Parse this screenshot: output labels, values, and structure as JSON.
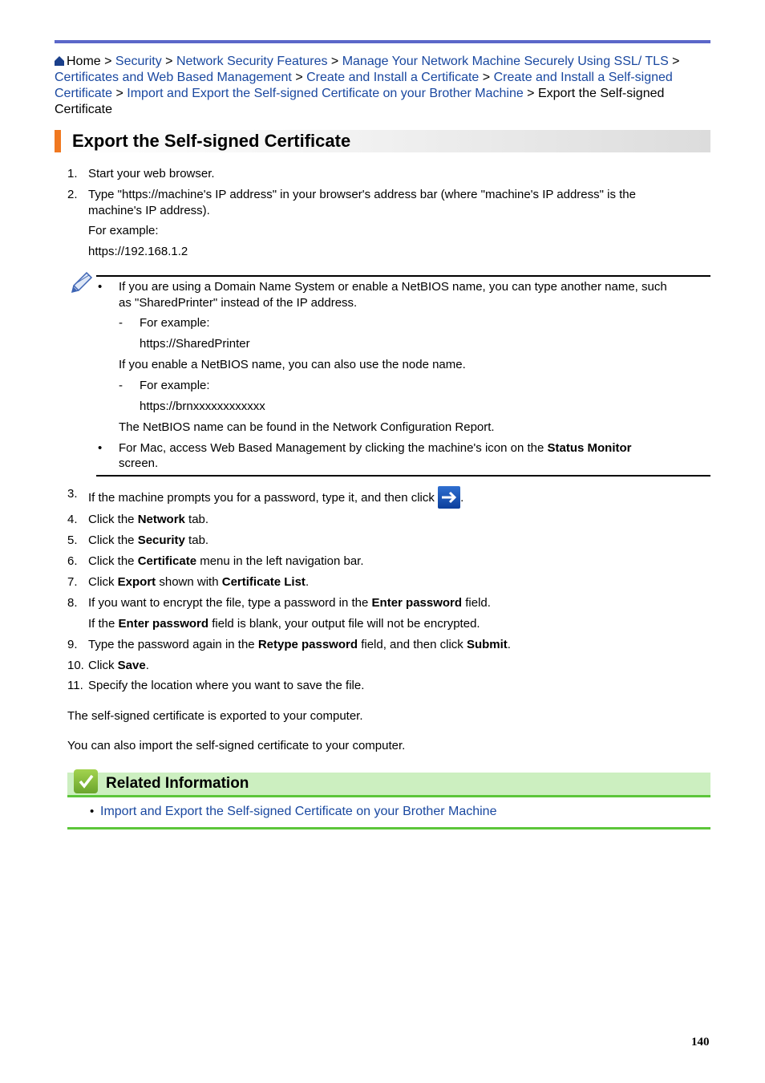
{
  "breadcrumb": {
    "home": "Home",
    "sep": " > ",
    "links": [
      "Security",
      "Network Security Features",
      "Manage Your Network Machine Securely Using SSL/ TLS",
      "Certificates and Web Based Management",
      "Create and Install a Certificate",
      "Create and Install a Self-signed Certificate",
      "Import and Export the Self-signed Certificate on your Brother Machine"
    ],
    "current": "Export the Self-signed Certificate"
  },
  "title": "Export the Self-signed Certificate",
  "steps": {
    "s1": {
      "num": "1.",
      "text": "Start your web browser."
    },
    "s2": {
      "num": "2.",
      "text": "Type \"https://machine's IP address\" in your browser's address bar (where \"machine's IP address\" is the machine's IP address).",
      "example_label": "For example:",
      "example_value": "https://192.168.1.2"
    },
    "s3": {
      "num": "3.",
      "text": "If the machine prompts you for a password, type it, and then click",
      "after": "."
    },
    "s4": {
      "num": "4.",
      "pre": "Click the ",
      "bold": "Network",
      "post": " tab."
    },
    "s5": {
      "num": "5.",
      "pre": "Click the ",
      "bold": "Security",
      "post": " tab."
    },
    "s6": {
      "num": "6.",
      "pre": "Click the ",
      "bold": "Certificate",
      "post": " menu in the left navigation bar."
    },
    "s7": {
      "num": "7.",
      "pre": "Click ",
      "bold": "Export",
      "mid": " shown with ",
      "bold2": "Certificate List",
      "post": "."
    },
    "s8": {
      "num": "8.",
      "pre": "If you want to encrypt the file, type a password in the ",
      "bold": "Enter password",
      "post": " field.",
      "sub_pre": "If the ",
      "sub_bold": "Enter password",
      "sub_post": " field is blank, your output file will not be encrypted."
    },
    "s9": {
      "num": "9.",
      "pre": "Type the password again in the ",
      "bold": "Retype password",
      "mid": " field, and then click ",
      "bold2": "Submit",
      "post": "."
    },
    "s10": {
      "num": "10.",
      "pre": "Click ",
      "bold": "Save",
      "post": "."
    },
    "s11": {
      "num": "11.",
      "text": "Specify the location where you want to save the file."
    }
  },
  "note": {
    "b1_line1": "If you are using a Domain Name System or enable a NetBIOS name, you can type another name, such",
    "b1_line2": "as \"SharedPrinter\" instead of the IP address.",
    "ex1_label": "For example:",
    "ex1_value": "https://SharedPrinter",
    "netbios_text": "If you enable a NetBIOS name, you can also use the node name.",
    "ex2_label": "For example:",
    "ex2_value": "https://brnxxxxxxxxxxxx",
    "netbios_report": "The NetBIOS name can be found in the Network Configuration Report.",
    "b2_pre": "For Mac, access Web Based Management by clicking the machine's icon on the ",
    "b2_bold": "Status Monitor",
    "b2_line2": "screen."
  },
  "result_text": "The self-signed certificate is exported to your computer.",
  "also_text": "You can also import the self-signed certificate to your computer.",
  "related": {
    "title": "Related Information",
    "link": "Import and Export the Self-signed Certificate on your Brother Machine"
  },
  "page_number": "140",
  "colors": {
    "link": "#1a48a0",
    "title_accent": "#f07820",
    "top_bar": "#5b67c9",
    "related_bg": "#ccefc0",
    "related_line": "#5cc63a"
  }
}
